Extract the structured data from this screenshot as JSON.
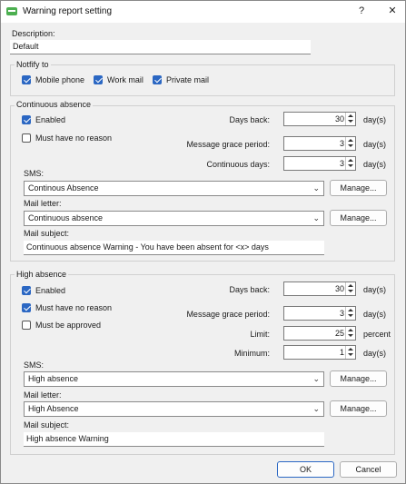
{
  "window": {
    "title": "Warning report setting",
    "help": "?",
    "close": "✕"
  },
  "description": {
    "label": "Description:",
    "value": "Default"
  },
  "notify": {
    "group_title": "Notfify to",
    "mobile_phone": "Mobile phone",
    "work_mail": "Work mail",
    "private_mail": "Private mail"
  },
  "continuous": {
    "group_title": "Continuous absence",
    "enabled_label": "Enabled",
    "no_reason_label": "Must have no reason",
    "days_back_label": "Days back:",
    "days_back_value": "30",
    "grace_label": "Message grace period:",
    "grace_value": "3",
    "cont_days_label": "Continuous days:",
    "cont_days_value": "3",
    "unit_days": "day(s)",
    "sms_label": "SMS:",
    "sms_value": "Continous Absence",
    "mail_letter_label": "Mail letter:",
    "mail_letter_value": "Continuous absence",
    "mail_subject_label": "Mail subject:",
    "mail_subject_value": "Continuous absence Warning - You have been absent for <x> days",
    "manage_label": "Manage..."
  },
  "high": {
    "group_title": "High absence",
    "enabled_label": "Enabled",
    "no_reason_label": "Must have no reason",
    "approved_label": "Must be approved",
    "days_back_label": "Days back:",
    "days_back_value": "30",
    "grace_label": "Message grace period:",
    "grace_value": "3",
    "limit_label": "Limit:",
    "limit_value": "25",
    "minimum_label": "Minimum:",
    "minimum_value": "1",
    "unit_days": "day(s)",
    "unit_percent": "percent",
    "sms_label": "SMS:",
    "sms_value": "High absence",
    "mail_letter_label": "Mail letter:",
    "mail_letter_value": "High Absence",
    "mail_subject_label": "Mail subject:",
    "mail_subject_value": "High absence Warning",
    "manage_label": "Manage..."
  },
  "footer": {
    "ok": "OK",
    "cancel": "Cancel"
  }
}
